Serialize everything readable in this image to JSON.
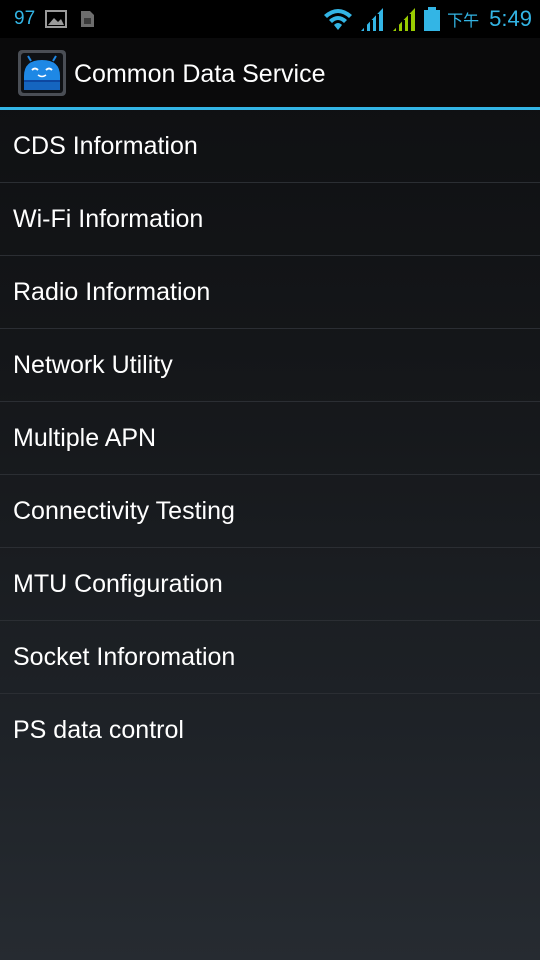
{
  "status_bar": {
    "notification_count": "97",
    "ampm": "下午",
    "time": "5:49"
  },
  "action_bar": {
    "title": "Common Data Service"
  },
  "menu": {
    "items": [
      {
        "label": "CDS Information"
      },
      {
        "label": "Wi-Fi Information"
      },
      {
        "label": "Radio Information"
      },
      {
        "label": "Network Utility"
      },
      {
        "label": "Multiple APN"
      },
      {
        "label": "Connectivity Testing"
      },
      {
        "label": "MTU Configuration"
      },
      {
        "label": "Socket Inforomation"
      },
      {
        "label": "PS data control"
      }
    ]
  },
  "colors": {
    "accent": "#33b5e5",
    "signal_green": "#99cc00"
  }
}
